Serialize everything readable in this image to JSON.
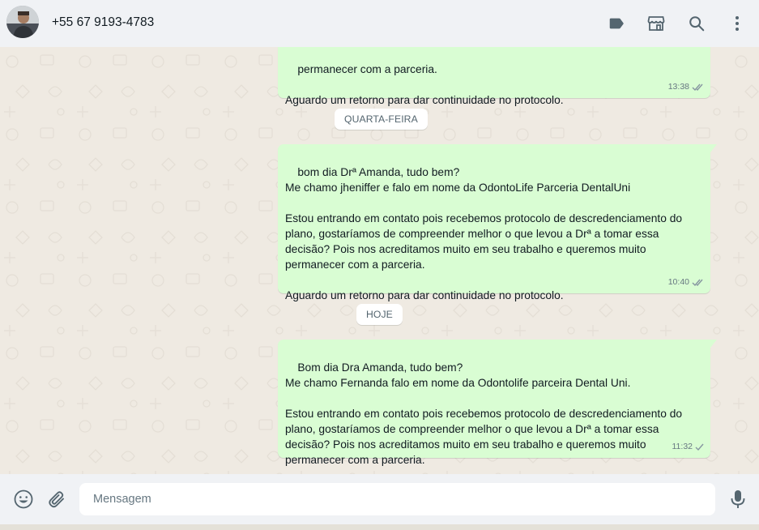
{
  "header": {
    "contact_name": "+55 67 9193-4783",
    "icons": [
      "label-icon",
      "catalog-icon",
      "search-icon",
      "menu-icon"
    ]
  },
  "messages": [
    {
      "text": "permanecer com a parceria.\n\nAguardo um retorno para dar continuidade no protocolo.",
      "time": "13:38",
      "status": "read"
    },
    {
      "text": "bom dia Drª Amanda, tudo bem?\nMe chamo jheniffer e falo em nome da OdontoLife Parceria DentalUni\n\nEstou entrando em contato pois recebemos protocolo de descredenciamento do plano, gostaríamos de compreender melhor o que levou a Drª a tomar essa decisão? Pois nos acreditamos muito em seu trabalho e queremos muito permanecer com a parceria.\n\nAguardo um retorno para dar continuidade no protocolo.",
      "time": "10:40",
      "status": "read"
    },
    {
      "text": "Bom dia Dra Amanda, tudo bem?\nMe chamo Fernanda falo em nome da Odontolife parceira Dental Uni.\n\nEstou entrando em contato pois recebemos protocolo de descredenciamento do plano, gostaríamos de compreender melhor o que levou a Drª a tomar essa decisão? Pois nos acreditamos muito em seu trabalho e queremos muito permanecer com a parceria.",
      "time": "11:32",
      "status": "sent"
    }
  ],
  "day_dividers": [
    "QUARTA-FEIRA",
    "HOJE"
  ],
  "composer": {
    "placeholder": "Mensagem",
    "icons": [
      "emoji-icon",
      "attach-icon",
      "microphone-icon"
    ]
  },
  "colors": {
    "outgoing_bubble": "#d9fdd3",
    "chat_background": "#efeae2",
    "header_background": "#f0f2f5",
    "read_check": "#8696a0"
  }
}
